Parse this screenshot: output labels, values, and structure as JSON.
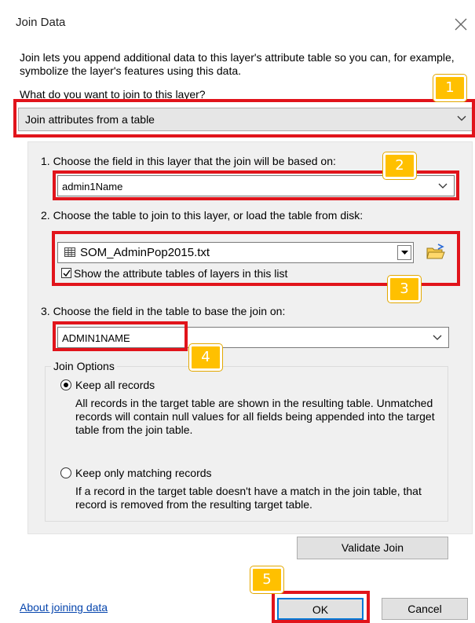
{
  "dialog": {
    "title": "Join Data",
    "description": "Join lets you append additional data to this layer's attribute table so you can, for example, symbolize the layer's features using this data.",
    "question": "What do you want to join to this layer?",
    "join_type": "Join attributes from a table"
  },
  "step1": {
    "label": "1.  Choose the field in this layer that the join will be based on:",
    "value": "admin1Name"
  },
  "step2": {
    "label": "2.  Choose the table to join to this layer, or load the table from disk:",
    "table": "SOM_AdminPop2015.txt",
    "checkbox_label": "Show the attribute tables of layers in this list",
    "checkbox_checked": true
  },
  "step3": {
    "label": "3.  Choose the field in the table to base the join on:",
    "value": "ADMIN1NAME"
  },
  "join_options": {
    "legend": "Join Options",
    "keep_all_label": "Keep all records",
    "keep_all_desc": "All records in the target table are shown in the resulting table. Unmatched records will contain null values for all fields being appended into the target table from the join table.",
    "keep_matching_label": "Keep only matching records",
    "keep_matching_desc": "If a record in the target table doesn't have a match in the join table, that record is removed from the resulting target table.",
    "selected": "keep_all"
  },
  "buttons": {
    "validate": "Validate Join",
    "ok": "OK",
    "cancel": "Cancel"
  },
  "help_link": "About joining data",
  "callouts": [
    "1",
    "2",
    "3",
    "4",
    "5"
  ],
  "colors": {
    "highlight": "#e1141b",
    "badge": "#ffc000",
    "link": "#0645ad"
  }
}
